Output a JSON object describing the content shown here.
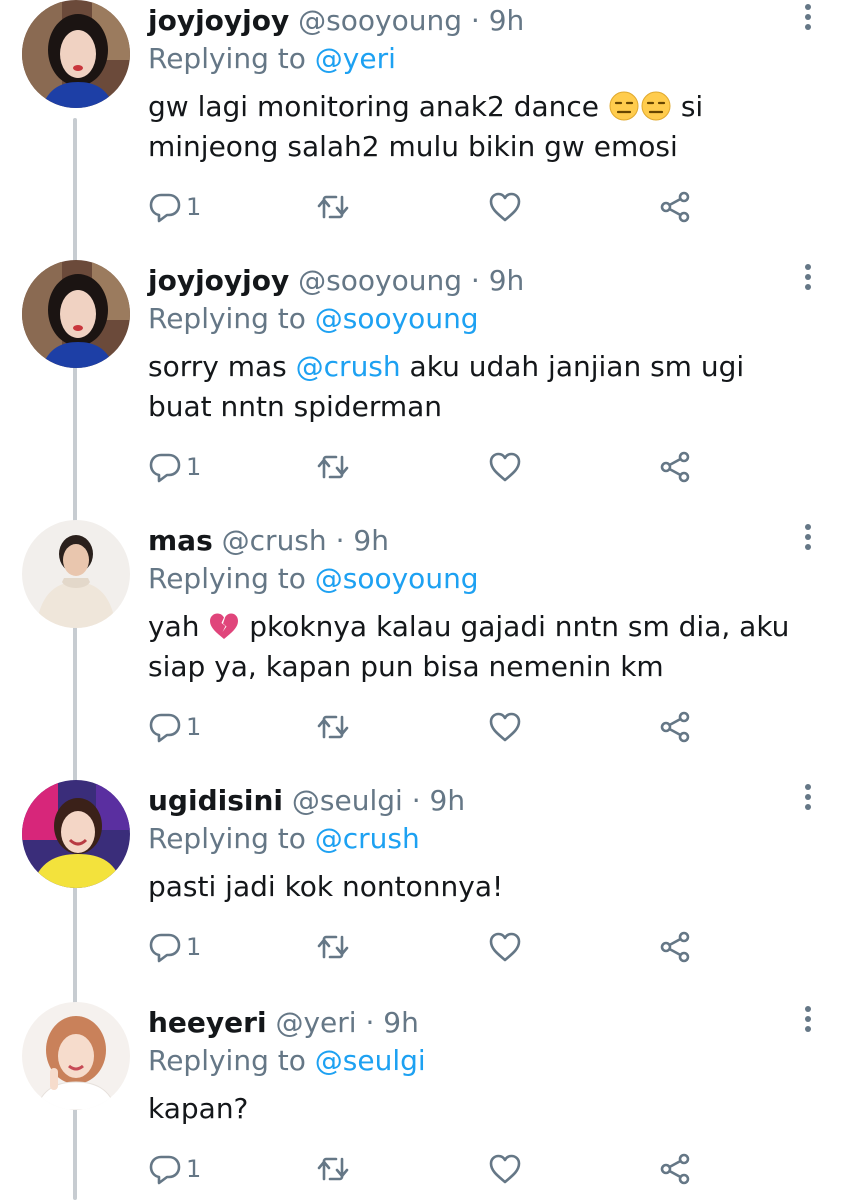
{
  "reply_prefix": "Replying to",
  "tweets": [
    {
      "name": "joyjoyjoy",
      "handle": "@sooyoung",
      "time": "9h",
      "reply_to": "@yeri",
      "text_before": "gw lagi monitoring anak2 dance ",
      "text_emoji": "😑😑",
      "text_after": " si minjeong salah2 mulu bikin gw emosi",
      "reply_count": "1"
    },
    {
      "name": "joyjoyjoy",
      "handle": "@sooyoung",
      "time": "9h",
      "reply_to": "@sooyoung",
      "text_before": "sorry mas ",
      "text_mention": "@crush",
      "text_after": " aku udah janjian sm ugi buat nntn spiderman",
      "reply_count": "1"
    },
    {
      "name": "mas",
      "handle": "@crush",
      "time": "9h",
      "reply_to": "@sooyoung",
      "text_before": "yah ",
      "text_emoji": "💔",
      "text_after": " pkoknya kalau gajadi nntn sm dia, aku siap ya, kapan pun bisa nemenin km",
      "reply_count": "1"
    },
    {
      "name": "ugidisini",
      "handle": "@seulgi",
      "time": "9h",
      "reply_to": "@crush",
      "text_before": "pasti jadi kok nontonnya!",
      "reply_count": "1"
    },
    {
      "name": "heeyeri",
      "handle": "@yeri",
      "time": "9h",
      "reply_to": "@seulgi",
      "text_before": "kapan?",
      "reply_count": "1"
    }
  ],
  "icons": {
    "reply": "reply-icon",
    "retweet": "retweet-icon",
    "like": "heart-icon",
    "share": "share-icon",
    "more": "more-vertical-icon"
  },
  "colors": {
    "name": "#14171a",
    "muted": "#657786",
    "mention": "#1da1f2",
    "thread_line": "#c7ccd1",
    "broken_heart": "#e0457b"
  }
}
